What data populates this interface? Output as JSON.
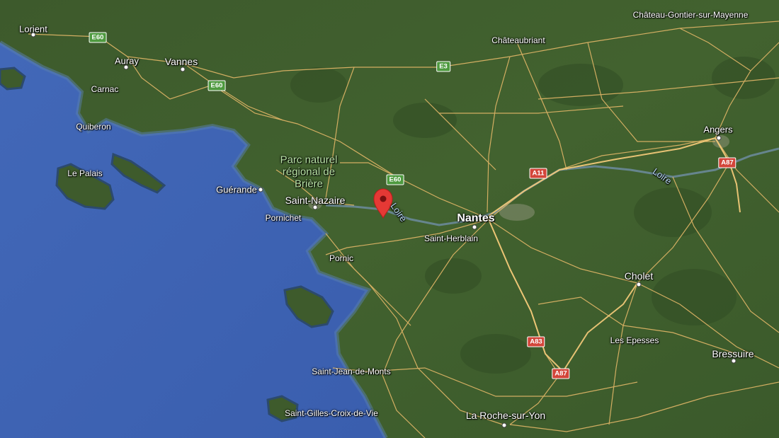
{
  "map": {
    "colors": {
      "sea": "#3d63b5",
      "land": "#3f5f2e",
      "roads": "#e3b768",
      "marker": "#e53935"
    },
    "places": [
      {
        "name": "Lorient"
      },
      {
        "name": "Auray"
      },
      {
        "name": "Vannes"
      },
      {
        "name": "Carnac"
      },
      {
        "name": "Quiberon"
      },
      {
        "name": "Le Palais"
      },
      {
        "name": "Guérande"
      },
      {
        "name": "Saint-Nazaire"
      },
      {
        "name": "Pornichet"
      },
      {
        "name": "Pornic"
      },
      {
        "name": "Saint-Jean-de-Monts"
      },
      {
        "name": "Saint-Gilles-Croix-de-Vie"
      },
      {
        "name": "Châteaubriant"
      },
      {
        "name": "Château-Gontier-sur-Mayenne"
      },
      {
        "name": "Angers"
      },
      {
        "name": "Nantes"
      },
      {
        "name": "Saint-Herblain"
      },
      {
        "name": "Cholet"
      },
      {
        "name": "Les Epesses"
      },
      {
        "name": "Bressuire"
      },
      {
        "name": "La Roche-sur-Yon"
      }
    ],
    "park_label": "Parc naturel régional de Brière",
    "rivers": [
      "Loire",
      "Loire"
    ],
    "road_shields": [
      {
        "label": "E60",
        "type": "euro"
      },
      {
        "label": "E60",
        "type": "euro"
      },
      {
        "label": "E3",
        "type": "euro"
      },
      {
        "label": "E60",
        "type": "euro"
      },
      {
        "label": "A11",
        "type": "motorway"
      },
      {
        "label": "A87",
        "type": "motorway"
      },
      {
        "label": "A83",
        "type": "motorway"
      },
      {
        "label": "A87",
        "type": "motorway"
      }
    ],
    "marker": {
      "name": "location-marker"
    }
  }
}
